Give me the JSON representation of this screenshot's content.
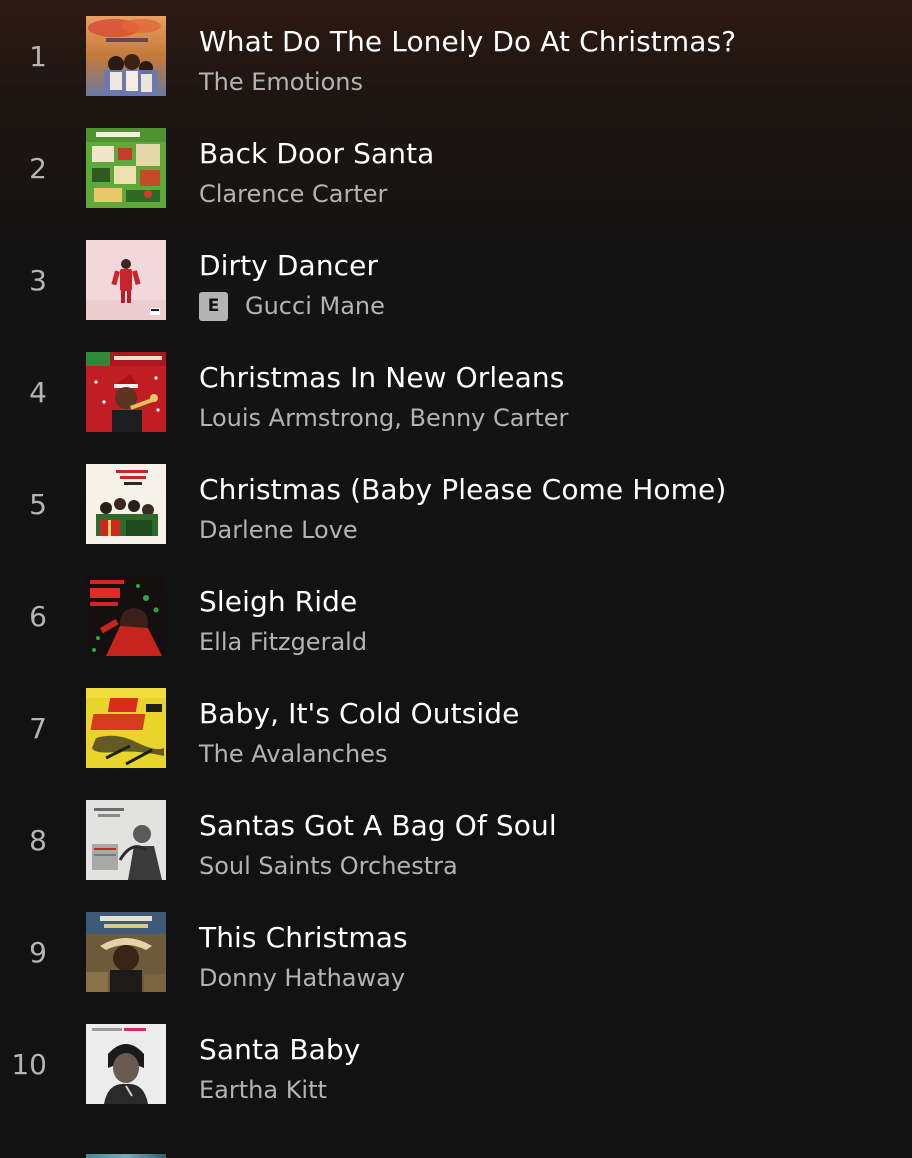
{
  "tracks": [
    {
      "number": "1",
      "title": "What Do The Lonely Do At Christmas?",
      "artist": "The Emotions",
      "explicit": false,
      "cover": "album-cover-sunshine"
    },
    {
      "number": "2",
      "title": "Back Door Santa",
      "artist": "Clarence Carter",
      "explicit": false,
      "cover": "album-cover-soul-christmas"
    },
    {
      "number": "3",
      "title": "Dirty Dancer",
      "artist": "Gucci Mane",
      "explicit": true,
      "explicit_label": "E",
      "cover": "album-cover-dirty-dancer"
    },
    {
      "number": "4",
      "title": "Christmas In New Orleans",
      "artist": "Louis Armstrong, Benny Carter",
      "explicit": false,
      "cover": "album-cover-louis-armstrong-friends"
    },
    {
      "number": "5",
      "title": "Christmas (Baby Please Come Home)",
      "artist": "Darlene Love",
      "explicit": false,
      "cover": "album-cover-christmas-gift"
    },
    {
      "number": "6",
      "title": "Sleigh Ride",
      "artist": "Ella Fitzgerald",
      "explicit": false,
      "cover": "album-cover-christmas-soul-essentials"
    },
    {
      "number": "7",
      "title": "Baby, It's Cold Outside",
      "artist": "The Avalanches",
      "explicit": false,
      "cover": "album-cover-ski-surfin"
    },
    {
      "number": "8",
      "title": "Santas Got A Bag Of Soul",
      "artist": "Soul Saints Orchestra",
      "explicit": false,
      "cover": "album-cover-soul-saints"
    },
    {
      "number": "9",
      "title": "This Christmas",
      "artist": "Donny Hathaway",
      "explicit": false,
      "cover": "album-cover-donny-hathaway"
    },
    {
      "number": "10",
      "title": "Santa Baby",
      "artist": "Eartha Kitt",
      "explicit": false,
      "cover": "album-cover-eartha-kitt"
    }
  ],
  "colors": {
    "background": "#121212",
    "header_tint": "#2e1a12",
    "title_text": "#ffffff",
    "secondary_text": "#b3b3b3",
    "explicit_badge": "#b3b3b3"
  }
}
